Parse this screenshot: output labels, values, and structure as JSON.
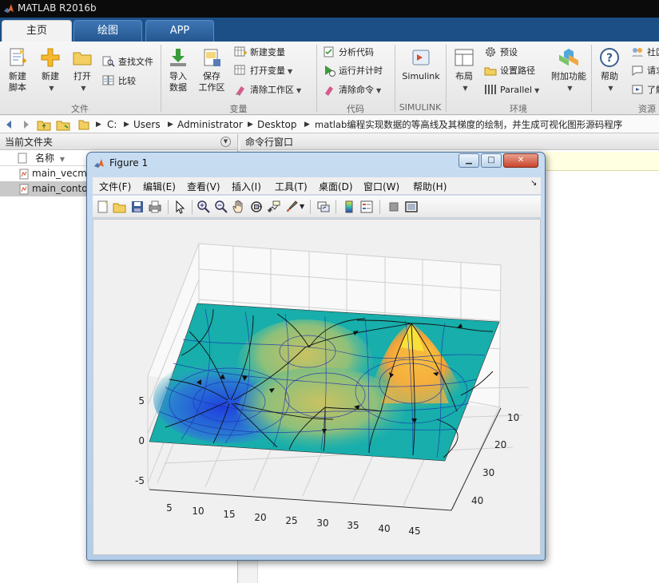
{
  "window": {
    "title": "MATLAB R2016b"
  },
  "tabs": [
    {
      "label": "主页",
      "active": true
    },
    {
      "label": "绘图",
      "active": false
    },
    {
      "label": "APP",
      "active": false
    }
  ],
  "ribbon": {
    "new_script": [
      "新建",
      "脚本"
    ],
    "new": "新建",
    "open": "打开",
    "find_files": "查找文件",
    "compare": "比较",
    "import": [
      "导入",
      "数据"
    ],
    "save_workspace": [
      "保存",
      "工作区"
    ],
    "new_variable": "新建变量",
    "open_variable": "打开变量",
    "clear_workspace": "清除工作区",
    "analyze_code": "分析代码",
    "run_time": "运行并计时",
    "clear_commands": "清除命令",
    "simulink": "Simulink",
    "layout": "布局",
    "preferences": "预设",
    "set_path": "设置路径",
    "parallel": "Parallel",
    "addons": "附加功能",
    "help": "帮助",
    "community": "社区",
    "request_support": "请求",
    "learn": "了解",
    "groups": {
      "file": "文件",
      "variable": "变量",
      "code": "代码",
      "simulink": "SIMULINK",
      "environment": "环境",
      "resources": "资源"
    }
  },
  "address": {
    "crumbs": [
      "C:",
      "Users",
      "Administrator",
      "Desktop",
      "matlab编程实现数据的等高线及其梯度的绘制，并生成可视化图形源码程序"
    ]
  },
  "current_folder": {
    "title": "当前文件夹",
    "column_name": "名称",
    "files": [
      {
        "name": "main_vecmap.m",
        "selected": false
      },
      {
        "name": "main_contour.m",
        "selected": true
      }
    ]
  },
  "command_window": {
    "title": "命令行窗口"
  },
  "figure": {
    "title": "Figure 1",
    "menus": [
      "文件(F)",
      "编辑(E)",
      "查看(V)",
      "插入(I)",
      "工具(T)",
      "桌面(D)",
      "窗口(W)",
      "帮助(H)"
    ],
    "toolbar_icons": [
      "new-figure-icon",
      "open-file-icon",
      "save-icon",
      "print-icon",
      "pointer-icon",
      "zoom-in-icon",
      "zoom-out-icon",
      "pan-icon",
      "rotate-3d-icon",
      "data-cursor-icon",
      "brush-icon",
      "link-plot-icon",
      "colorbar-icon",
      "legend-icon",
      "hide-plot-tools-icon",
      "show-plot-tools-icon"
    ],
    "z_ticks": [
      "5",
      "0",
      "-5"
    ],
    "x_ticks": [
      "5",
      "10",
      "15",
      "20",
      "25",
      "30",
      "35",
      "40",
      "45"
    ],
    "y_ticks": [
      "10",
      "20",
      "30",
      "40"
    ]
  }
}
